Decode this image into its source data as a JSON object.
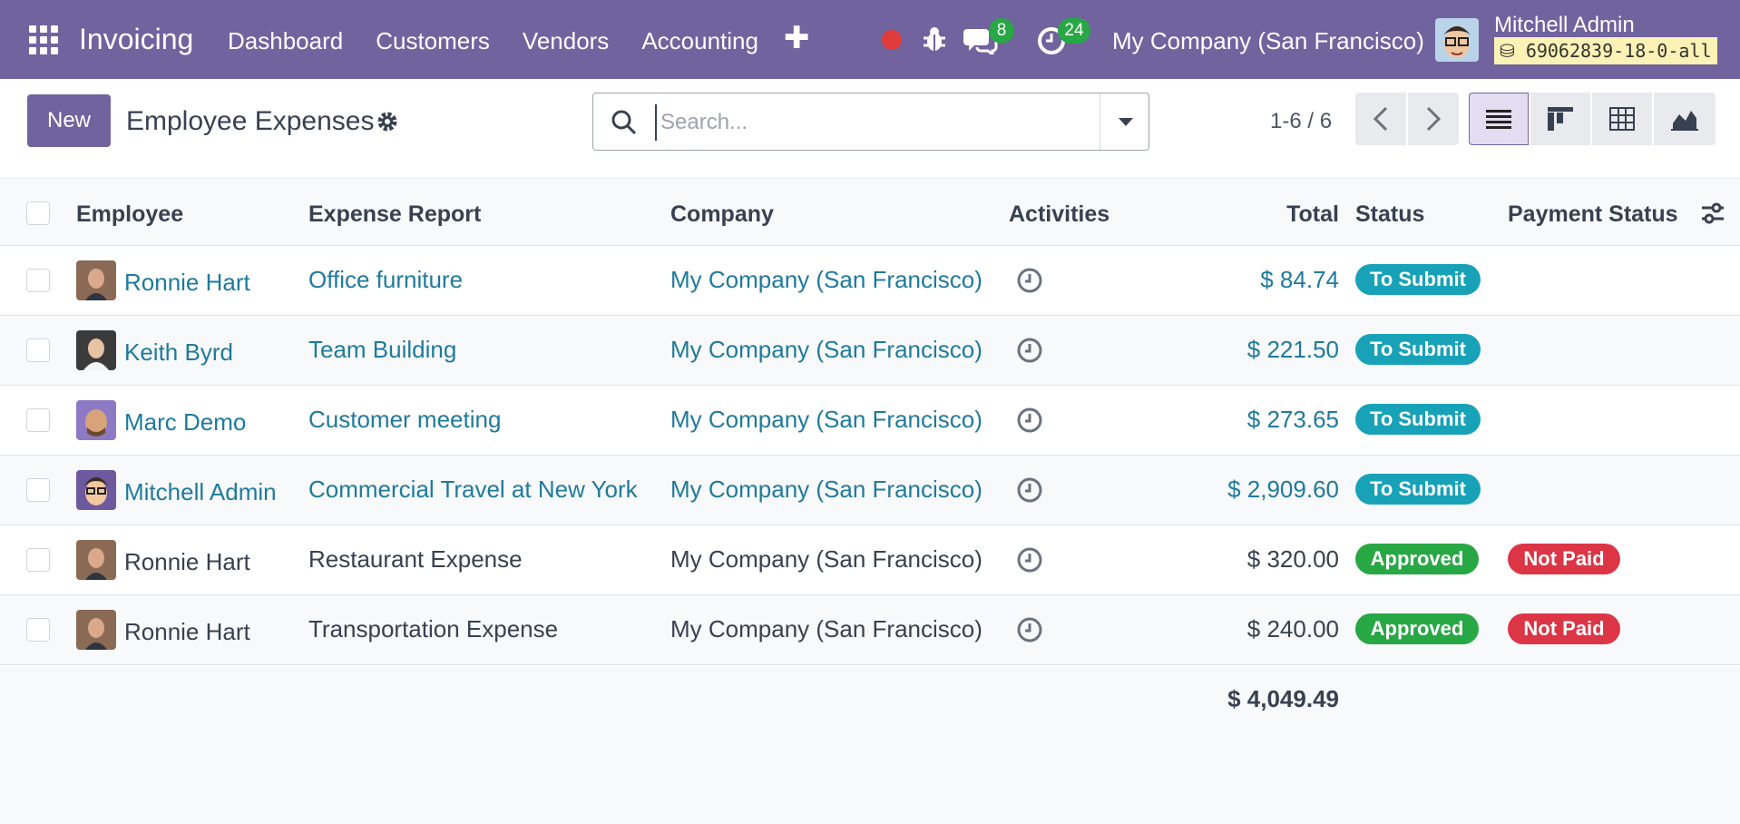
{
  "navbar": {
    "brand": "Invoicing",
    "menu": [
      "Dashboard",
      "Customers",
      "Vendors",
      "Accounting"
    ],
    "plus_icon": "plus-icon",
    "messages_count": "8",
    "activities_count": "24",
    "company": "My Company (San Francisco)",
    "user_name": "Mitchell Admin",
    "database": "69062839-18-0-all",
    "colors": {
      "navbar_bg": "#71639e",
      "record": "#e03b3b",
      "badge": "#28a745"
    }
  },
  "control": {
    "new_label": "New",
    "title": "Employee Expenses",
    "search_placeholder": "Search...",
    "pager": "1-6 / 6"
  },
  "table": {
    "headers": {
      "employee": "Employee",
      "report": "Expense Report",
      "company": "Company",
      "activities": "Activities",
      "total": "Total",
      "status": "Status",
      "payment": "Payment Status"
    },
    "rows": [
      {
        "employee": "Ronnie Hart",
        "report": "Office furniture",
        "company": "My Company (San Francisco)",
        "total": "$ 84.74",
        "status": "To Submit",
        "payment": ""
      },
      {
        "employee": "Keith Byrd",
        "report": "Team Building",
        "company": "My Company (San Francisco)",
        "total": "$ 221.50",
        "status": "To Submit",
        "payment": ""
      },
      {
        "employee": "Marc Demo",
        "report": "Customer meeting",
        "company": "My Company (San Francisco)",
        "total": "$ 273.65",
        "status": "To Submit",
        "payment": ""
      },
      {
        "employee": "Mitchell Admin",
        "report": "Commercial Travel at New York",
        "company": "My Company (San Francisco)",
        "total": "$ 2,909.60",
        "status": "To Submit",
        "payment": ""
      },
      {
        "employee": "Ronnie Hart",
        "report": "Restaurant Expense",
        "company": "My Company (San Francisco)",
        "total": "$ 320.00",
        "status": "Approved",
        "payment": "Not Paid"
      },
      {
        "employee": "Ronnie Hart",
        "report": "Transportation Expense",
        "company": "My Company (San Francisco)",
        "total": "$ 240.00",
        "status": "Approved",
        "payment": "Not Paid"
      }
    ],
    "grand_total": "$ 4,049.49",
    "colors": {
      "link": "#1f7a9c",
      "to_submit": "#17a2b8",
      "approved": "#28a745",
      "not_paid": "#dc3545"
    }
  }
}
